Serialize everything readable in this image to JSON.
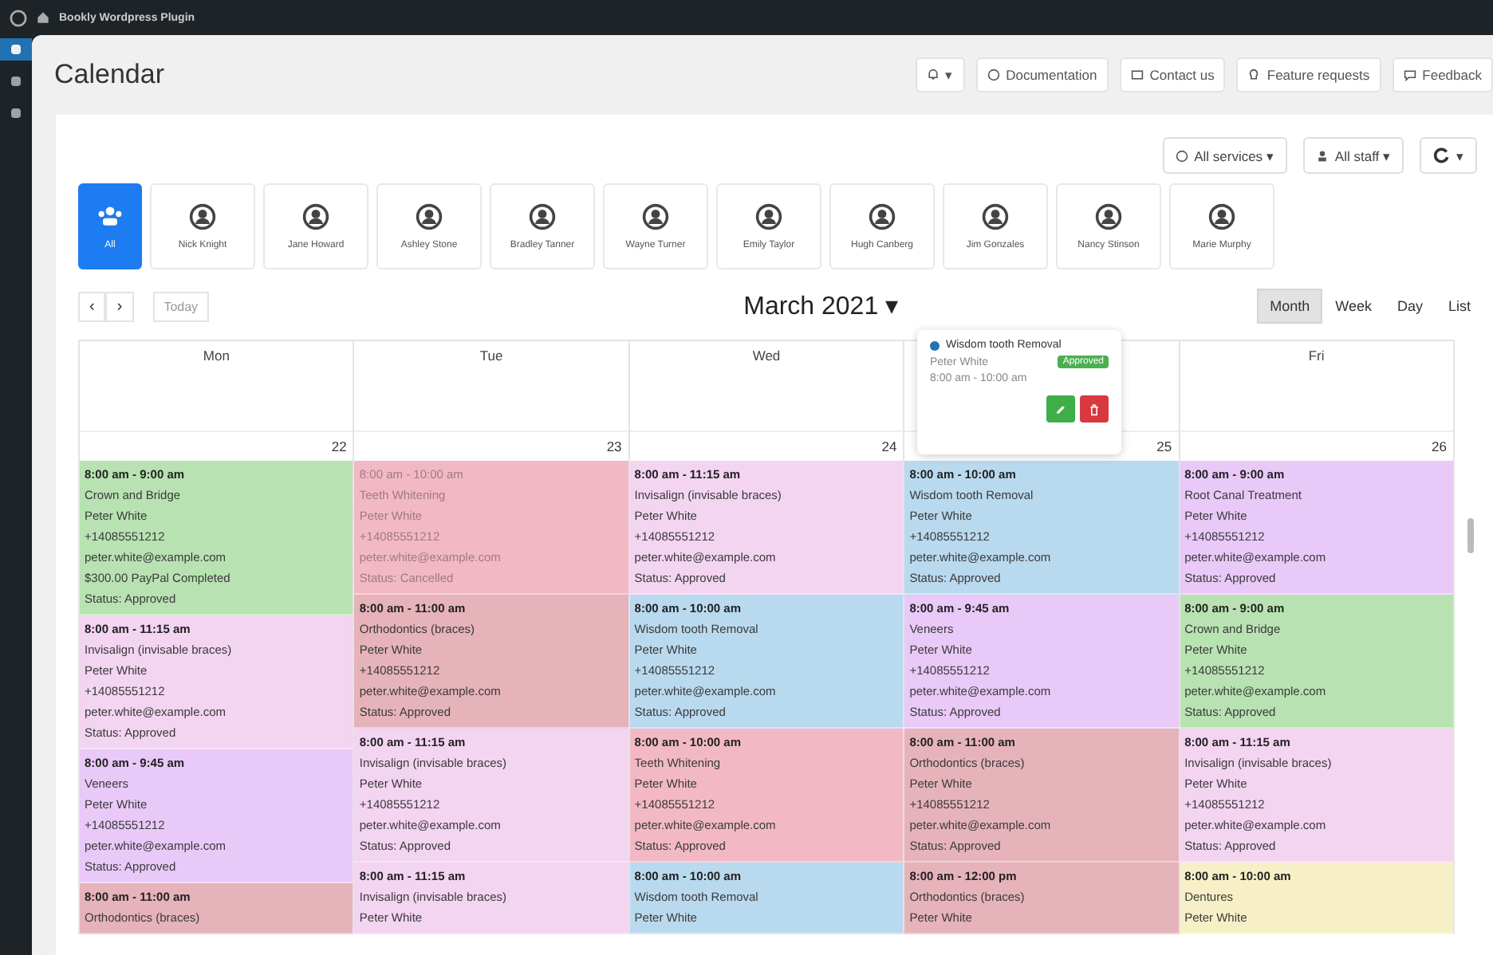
{
  "top_bar": {
    "title": "Bookly Wordpress Plugin"
  },
  "sidebar": {
    "items": [
      {
        "selected": true
      },
      {
        "selected": false
      },
      {
        "selected": false
      }
    ]
  },
  "page": {
    "title": "Calendar"
  },
  "header_buttons": [
    {
      "kind": "notifications",
      "label": "▾"
    },
    {
      "kind": "doc",
      "label": "Documentation"
    },
    {
      "kind": "mail",
      "label": "Contact us"
    },
    {
      "kind": "idea",
      "label": "Feature requests"
    },
    {
      "kind": "chat",
      "label": "Feedback"
    }
  ],
  "filters": [
    {
      "kind": "services",
      "label": "All services ▾"
    },
    {
      "kind": "staff",
      "label": "All staff ▾"
    },
    {
      "kind": "refresh",
      "label": "▾"
    }
  ],
  "staff": [
    {
      "name": "All",
      "selected": true
    },
    {
      "name": "Nick Knight",
      "selected": false
    },
    {
      "name": "Jane Howard",
      "selected": false
    },
    {
      "name": "Ashley Stone",
      "selected": false
    },
    {
      "name": "Bradley Tanner",
      "selected": false
    },
    {
      "name": "Wayne Turner",
      "selected": false
    },
    {
      "name": "Emily Taylor",
      "selected": false
    },
    {
      "name": "Hugh Canberg",
      "selected": false
    },
    {
      "name": "Jim Gonzales",
      "selected": false
    },
    {
      "name": "Nancy Stinson",
      "selected": false
    },
    {
      "name": "Marie Murphy",
      "selected": false
    }
  ],
  "nav": {
    "prev": "‹",
    "next": "›",
    "today": "Today",
    "title": "March 2021 ▾"
  },
  "views": [
    {
      "label": "Month",
      "selected": true
    },
    {
      "label": "Week",
      "selected": false
    },
    {
      "label": "Day",
      "selected": false
    },
    {
      "label": "List",
      "selected": false
    }
  ],
  "days": [
    {
      "name": "Mon",
      "date": "22",
      "events": [
        {
          "color": "#b8e2b2",
          "cancelled": false,
          "time": "8:00 am - 9:00 am",
          "lines": [
            "Crown and Bridge",
            "Peter White",
            "+14085551212",
            "peter.white@example.com",
            "$300.00 PayPal Completed",
            "Status: Approved"
          ]
        },
        {
          "color": "#f3d4f1",
          "cancelled": false,
          "time": "8:00 am - 11:15 am",
          "lines": [
            "Invisalign (invisable braces)",
            "Peter White",
            "+14085551212",
            "peter.white@example.com",
            "Status: Approved"
          ]
        },
        {
          "color": "#e9c9f8",
          "cancelled": false,
          "time": "8:00 am - 9:45 am",
          "lines": [
            "Veneers",
            "Peter White",
            "+14085551212",
            "peter.white@example.com",
            "Status: Approved"
          ]
        },
        {
          "color": "#e6b3bb",
          "cancelled": false,
          "time": "8:00 am - 11:00 am",
          "lines": [
            "Orthodontics (braces)"
          ]
        }
      ]
    },
    {
      "name": "Tue",
      "date": "23",
      "events": [
        {
          "color": "#f2b9c4",
          "cancelled": true,
          "time": "8:00 am - 10:00 am",
          "lines": [
            "Teeth Whitening",
            "Peter White",
            "+14085551212",
            "peter.white@example.com",
            "Status: Cancelled"
          ]
        },
        {
          "color": "#e6b3bb",
          "cancelled": false,
          "time": "8:00 am - 11:00 am",
          "lines": [
            "Orthodontics (braces)",
            "Peter White",
            "+14085551212",
            "peter.white@example.com",
            "Status: Approved"
          ]
        },
        {
          "color": "#f3d4f1",
          "cancelled": false,
          "time": "8:00 am - 11:15 am",
          "lines": [
            "Invisalign (invisable braces)",
            "Peter White",
            "+14085551212",
            "peter.white@example.com",
            "Status: Approved"
          ]
        },
        {
          "color": "#f3d4f1",
          "cancelled": false,
          "time": "8:00 am - 11:15 am",
          "lines": [
            "Invisalign (invisable braces)",
            "Peter White"
          ]
        }
      ]
    },
    {
      "name": "Wed",
      "date": "24",
      "events": [
        {
          "color": "#f3d4f1",
          "cancelled": false,
          "time": "8:00 am - 11:15 am",
          "lines": [
            "Invisalign (invisable braces)",
            "Peter White",
            "+14085551212",
            "peter.white@example.com",
            "Status: Approved"
          ]
        },
        {
          "color": "#b9d9ee",
          "cancelled": false,
          "time": "8:00 am - 10:00 am",
          "lines": [
            "Wisdom tooth Removal",
            "Peter White",
            "+14085551212",
            "peter.white@example.com",
            "Status: Approved"
          ]
        },
        {
          "color": "#f2b9c4",
          "cancelled": false,
          "time": "8:00 am - 10:00 am",
          "lines": [
            "Teeth Whitening",
            "Peter White",
            "+14085551212",
            "peter.white@example.com",
            "Status: Approved"
          ]
        },
        {
          "color": "#b9d9ee",
          "cancelled": false,
          "time": "8:00 am - 10:00 am",
          "lines": [
            "Wisdom tooth Removal",
            "Peter White"
          ]
        }
      ]
    },
    {
      "date": "25",
      "events": [
        {
          "color": "#b9d9ee",
          "cancelled": false,
          "time": "8:00 am - 10:00 am",
          "lines": [
            "Wisdom tooth Removal",
            "Peter White",
            "+14085551212",
            "peter.white@example.com",
            "Status: Approved"
          ]
        },
        {
          "color": "#e9c9f8",
          "cancelled": false,
          "time": "8:00 am - 9:45 am",
          "lines": [
            "Veneers",
            "Peter White",
            "+14085551212",
            "peter.white@example.com",
            "Status: Approved"
          ]
        },
        {
          "color": "#e6b3bb",
          "cancelled": false,
          "time": "8:00 am - 11:00 am",
          "lines": [
            "Orthodontics (braces)",
            "Peter White",
            "+14085551212",
            "peter.white@example.com",
            "Status: Approved"
          ]
        },
        {
          "color": "#e6b3bb",
          "cancelled": false,
          "time": "8:00 am - 12:00 pm",
          "lines": [
            "Orthodontics (braces)",
            "Peter White"
          ]
        }
      ]
    },
    {
      "name": "Fri",
      "date": "26",
      "events": [
        {
          "color": "#e9c9f8",
          "cancelled": false,
          "time": "8:00 am - 9:00 am",
          "lines": [
            "Root Canal Treatment",
            "Peter White",
            "+14085551212",
            "peter.white@example.com",
            "Status: Approved"
          ]
        },
        {
          "color": "#b8e2b2",
          "cancelled": false,
          "time": "8:00 am - 9:00 am",
          "lines": [
            "Crown and Bridge",
            "Peter White",
            "+14085551212",
            "peter.white@example.com",
            "Status: Approved"
          ]
        },
        {
          "color": "#f3d4f1",
          "cancelled": false,
          "time": "8:00 am - 11:15 am",
          "lines": [
            "Invisalign (invisable braces)",
            "Peter White",
            "+14085551212",
            "peter.white@example.com",
            "Status: Approved"
          ]
        },
        {
          "color": "#f7f0c6",
          "cancelled": false,
          "time": "8:00 am - 10:00 am",
          "lines": [
            "Dentures",
            "Peter White"
          ]
        }
      ]
    }
  ],
  "popover": {
    "title": "Wisdom tooth Removal",
    "customer": "Peter White",
    "status": "Approved",
    "time": "8:00 am - 10:00 am"
  }
}
